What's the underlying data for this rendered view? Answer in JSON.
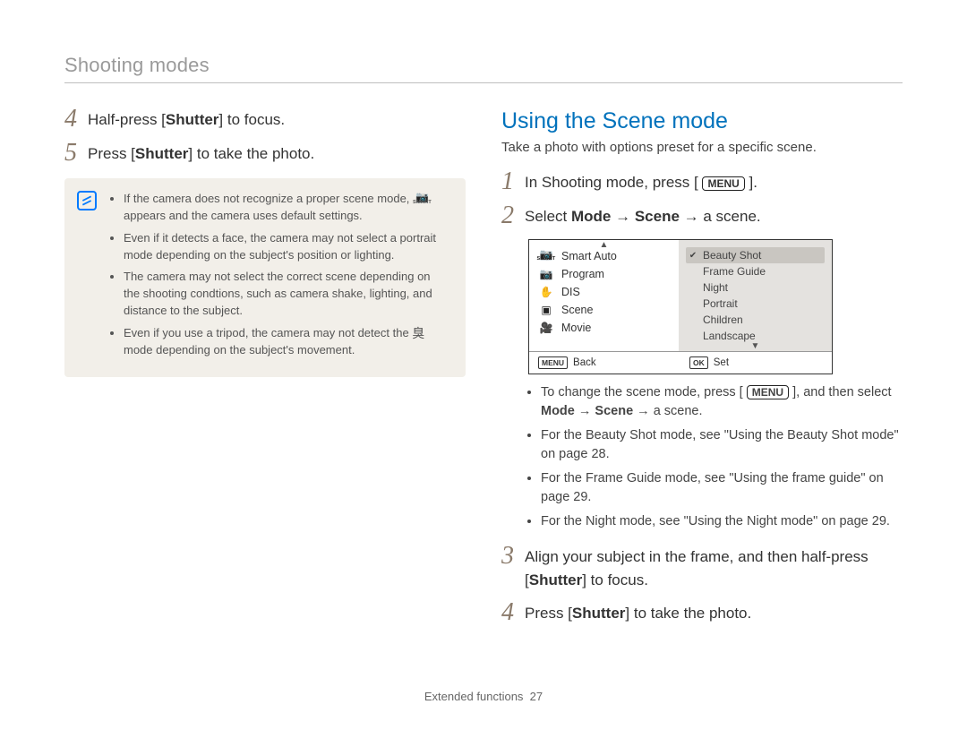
{
  "header": "Shooting modes",
  "left": {
    "step4": {
      "num": "4",
      "pre": "Half-press [",
      "bold": "Shutter",
      "post": "] to focus."
    },
    "step5": {
      "num": "5",
      "pre": "Press [",
      "bold": "Shutter",
      "post": "] to take the photo."
    },
    "notes": [
      {
        "pre": "If the camera does not recognize a proper scene mode, ",
        "icon": "smart",
        "post": " appears and the camera uses default settings."
      },
      {
        "pre": "Even if it detects a face, the camera may not select a portrait mode depending on the subject's position or lighting.",
        "icon": null,
        "post": ""
      },
      {
        "pre": "The camera may not select the correct scene depending on the shooting condtions, such as camera shake, lighting, and distance to the subject.",
        "icon": null,
        "post": ""
      },
      {
        "pre": "Even if you use a tripod, the camera may not detect the ",
        "icon": "tripod",
        "post": " mode depending on the subject's movement."
      }
    ]
  },
  "right": {
    "heading": "Using the Scene mode",
    "sub": "Take a photo with options preset for a specific scene.",
    "step1": {
      "num": "1",
      "pre": "In Shooting mode, press [ ",
      "menu": "MENU",
      "post": " ]."
    },
    "step2": {
      "num": "2",
      "pre": "Select ",
      "bold": "Mode → Scene",
      "post": " → a scene."
    },
    "screenshot": {
      "left_items": [
        {
          "icon": "smart",
          "label": "Smart Auto"
        },
        {
          "icon": "camera",
          "label": "Program"
        },
        {
          "icon": "hand",
          "label": "DIS"
        },
        {
          "icon": "scene",
          "label": "Scene"
        },
        {
          "icon": "movie",
          "label": "Movie"
        }
      ],
      "right_items": [
        {
          "label": "Beauty Shot",
          "selected": true
        },
        {
          "label": "Frame Guide",
          "selected": false
        },
        {
          "label": "Night",
          "selected": false
        },
        {
          "label": "Portrait",
          "selected": false
        },
        {
          "label": "Children",
          "selected": false
        },
        {
          "label": "Landscape",
          "selected": false
        }
      ],
      "footer": {
        "back_key": "MENU",
        "back_label": "Back",
        "set_key": "OK",
        "set_label": "Set"
      }
    },
    "bullets": [
      {
        "pre": "To change the scene mode, press [ ",
        "menu": "MENU",
        "mid": " ], and then select ",
        "bold": "Mode → Scene →",
        "post": " a scene."
      },
      {
        "pre": "For the Beauty Shot mode, see \"Using the Beauty Shot mode\" on page 28.",
        "menu": null,
        "mid": "",
        "bold": "",
        "post": ""
      },
      {
        "pre": "For the Frame Guide mode, see \"Using the frame guide\" on page 29.",
        "menu": null,
        "mid": "",
        "bold": "",
        "post": ""
      },
      {
        "pre": "For the Night mode, see \"Using the Night mode\" on page 29.",
        "menu": null,
        "mid": "",
        "bold": "",
        "post": ""
      }
    ],
    "step3": {
      "num": "3",
      "pre": "Align your subject in the frame, and then half-press [",
      "bold": "Shutter",
      "post": "] to focus."
    },
    "step4": {
      "num": "4",
      "pre": "Press [",
      "bold": "Shutter",
      "post": "] to take the photo."
    }
  },
  "footer": {
    "label": "Extended functions",
    "page": "27"
  }
}
